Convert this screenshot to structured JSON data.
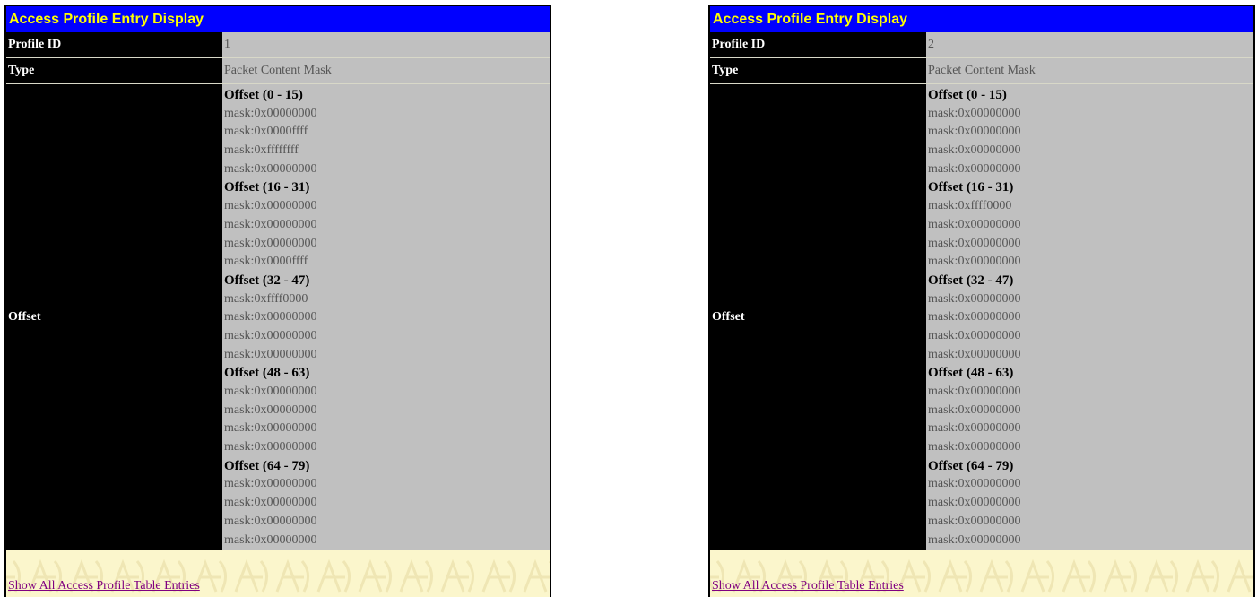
{
  "panels": [
    {
      "title": "Access Profile Entry Display",
      "profile_id_label": "Profile ID",
      "profile_id_value": "1",
      "type_label": "Type",
      "type_value": "Packet Content Mask",
      "offset_label": "Offset",
      "offset_lines": [
        "Offset (0 - 15)",
        "mask:0x00000000",
        "mask:0x0000ffff",
        "mask:0xffffffff",
        "mask:0x00000000",
        "Offset (16 - 31)",
        "mask:0x00000000",
        "mask:0x00000000",
        "mask:0x00000000",
        "mask:0x0000ffff",
        "Offset (32 - 47)",
        "mask:0xffff0000",
        "mask:0x00000000",
        "mask:0x00000000",
        "mask:0x00000000",
        "Offset (48 - 63)",
        "mask:0x00000000",
        "mask:0x00000000",
        "mask:0x00000000",
        "mask:0x00000000",
        "Offset (64 - 79)",
        "mask:0x00000000",
        "mask:0x00000000",
        "mask:0x00000000",
        "mask:0x00000000"
      ],
      "link_text": "Show All Access Profile Table Entries"
    },
    {
      "title": "Access Profile Entry Display",
      "profile_id_label": "Profile ID",
      "profile_id_value": "2",
      "type_label": "Type",
      "type_value": "Packet Content Mask",
      "offset_label": "Offset",
      "offset_lines": [
        "Offset (0 - 15)",
        "mask:0x00000000",
        "mask:0x00000000",
        "mask:0x00000000",
        "mask:0x00000000",
        "Offset (16 - 31)",
        "mask:0xffff0000",
        "mask:0x00000000",
        "mask:0x00000000",
        "mask:0x00000000",
        "Offset (32 - 47)",
        "mask:0x00000000",
        "mask:0x00000000",
        "mask:0x00000000",
        "mask:0x00000000",
        "Offset (48 - 63)",
        "mask:0x00000000",
        "mask:0x00000000",
        "mask:0x00000000",
        "mask:0x00000000",
        "Offset (64 - 79)",
        "mask:0x00000000",
        "mask:0x00000000",
        "mask:0x00000000",
        "mask:0x00000000"
      ],
      "link_text": "Show All Access Profile Table Entries"
    }
  ],
  "colors": {
    "header_bg": "#0000ff",
    "header_text": "#ffff00",
    "label_bg": "#000000",
    "value_bg": "#c0c0c0",
    "footer_bg": "#fbf6cc",
    "link": "#800080"
  }
}
